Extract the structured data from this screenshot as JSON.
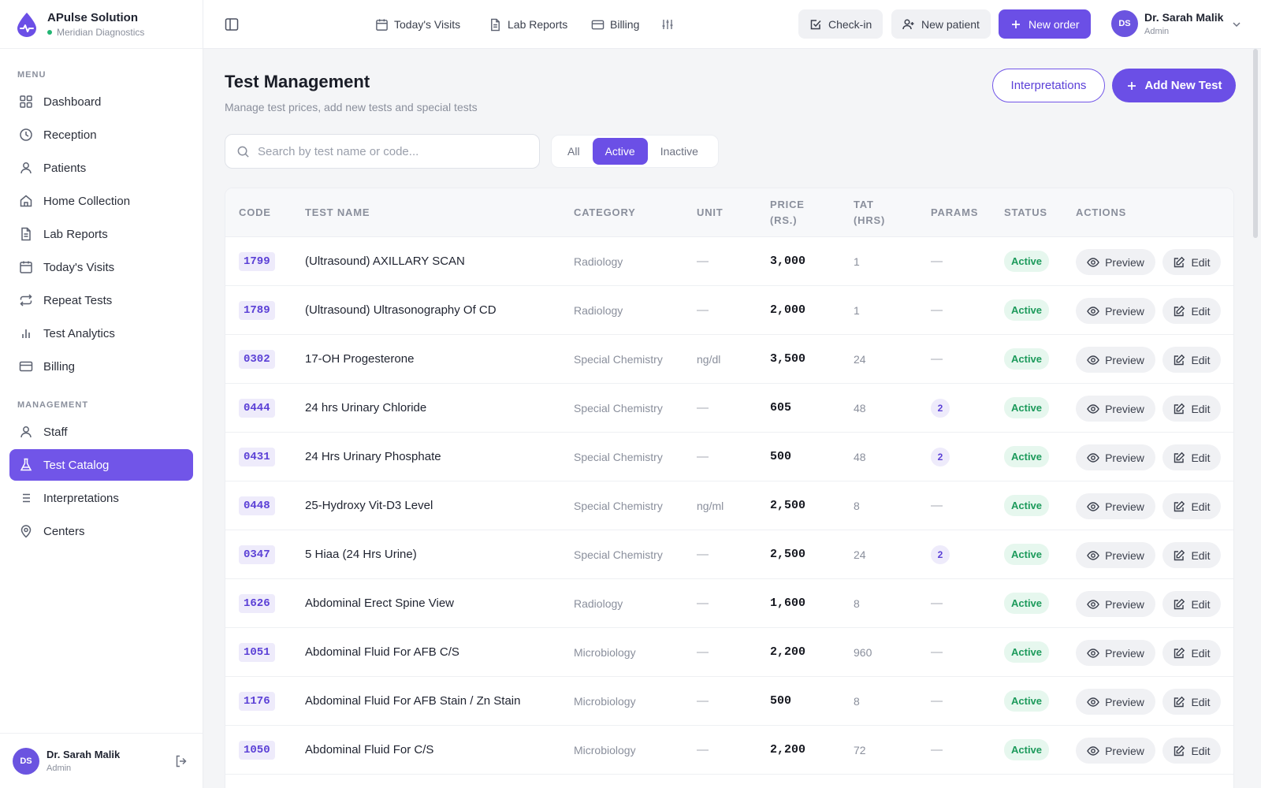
{
  "brand": {
    "name": "APulse Solution",
    "subtitle": "Meridian Diagnostics",
    "accent": "#6b4fe6",
    "status_color": "#22b573"
  },
  "sidebar": {
    "section_menu": "MENU",
    "section_management": "MANAGEMENT",
    "menu_items": [
      {
        "label": "Dashboard",
        "icon": "grid-icon"
      },
      {
        "label": "Reception",
        "icon": "clock-icon"
      },
      {
        "label": "Patients",
        "icon": "user-icon"
      },
      {
        "label": "Home Collection",
        "icon": "home-icon"
      },
      {
        "label": "Lab Reports",
        "icon": "file-icon"
      },
      {
        "label": "Today's Visits",
        "icon": "calendar-icon"
      },
      {
        "label": "Repeat Tests",
        "icon": "repeat-icon"
      },
      {
        "label": "Test Analytics",
        "icon": "bar-chart-icon"
      },
      {
        "label": "Billing",
        "icon": "credit-card-icon"
      }
    ],
    "management_items": [
      {
        "label": "Staff",
        "icon": "user-icon"
      },
      {
        "label": "Test Catalog",
        "icon": "flask-icon",
        "active": true
      },
      {
        "label": "Interpretations",
        "icon": "list-icon"
      },
      {
        "label": "Centers",
        "icon": "map-pin-icon"
      }
    ],
    "user": {
      "initials": "DS",
      "name": "Dr. Sarah Malik",
      "role": "Admin"
    }
  },
  "topbar": {
    "links": [
      {
        "label": "Today's Visits",
        "icon": "calendar-icon"
      },
      {
        "label": "Lab Reports",
        "icon": "file-icon"
      },
      {
        "label": "Billing",
        "icon": "credit-card-icon"
      }
    ],
    "checkin_label": "Check-in",
    "new_patient_label": "New patient",
    "new_order_label": "New order",
    "user": {
      "initials": "DS",
      "name": "Dr. Sarah Malik",
      "role": "Admin"
    }
  },
  "page": {
    "title": "Test Management",
    "subtitle": "Manage test prices, add new tests and special tests",
    "interpretations_label": "Interpretations",
    "add_label": "Add New Test"
  },
  "search": {
    "placeholder": "Search by test name or code...",
    "value": ""
  },
  "filter": {
    "options": [
      "All",
      "Active",
      "Inactive"
    ],
    "selected": "Active"
  },
  "table": {
    "headers": {
      "code": "CODE",
      "name": "TEST NAME",
      "category": "CATEGORY",
      "unit": "UNIT",
      "price_1": "PRICE",
      "price_2": "(RS.)",
      "tat_1": "TAT",
      "tat_2": "(HRS)",
      "params": "PARAMS",
      "status": "STATUS",
      "actions": "ACTIONS"
    },
    "preview_label": "Preview",
    "edit_label": "Edit",
    "rows": [
      {
        "code": "1799",
        "name": "(Ultrasound) AXILLARY SCAN",
        "category": "Radiology",
        "unit": "—",
        "price": "3,000",
        "tat": "1",
        "params": "—",
        "status": "Active"
      },
      {
        "code": "1789",
        "name": "(Ultrasound) Ultrasonography Of CD",
        "category": "Radiology",
        "unit": "—",
        "price": "2,000",
        "tat": "1",
        "params": "—",
        "status": "Active"
      },
      {
        "code": "0302",
        "name": "17-OH Progesterone",
        "category": "Special Chemistry",
        "unit": "ng/dl",
        "price": "3,500",
        "tat": "24",
        "params": "—",
        "status": "Active"
      },
      {
        "code": "0444",
        "name": "24 hrs Urinary Chloride",
        "category": "Special Chemistry",
        "unit": "—",
        "price": "605",
        "tat": "48",
        "params": "2",
        "status": "Active"
      },
      {
        "code": "0431",
        "name": "24 Hrs Urinary Phosphate",
        "category": "Special Chemistry",
        "unit": "—",
        "price": "500",
        "tat": "48",
        "params": "2",
        "status": "Active"
      },
      {
        "code": "0448",
        "name": "25-Hydroxy Vit-D3 Level",
        "category": "Special Chemistry",
        "unit": "ng/ml",
        "price": "2,500",
        "tat": "8",
        "params": "—",
        "status": "Active"
      },
      {
        "code": "0347",
        "name": "5 Hiaa (24 Hrs Urine)",
        "category": "Special Chemistry",
        "unit": "—",
        "price": "2,500",
        "tat": "24",
        "params": "2",
        "status": "Active"
      },
      {
        "code": "1626",
        "name": "Abdominal Erect Spine View",
        "category": "Radiology",
        "unit": "—",
        "price": "1,600",
        "tat": "8",
        "params": "—",
        "status": "Active"
      },
      {
        "code": "1051",
        "name": "Abdominal Fluid For AFB C/S",
        "category": "Microbiology",
        "unit": "—",
        "price": "2,200",
        "tat": "960",
        "params": "—",
        "status": "Active"
      },
      {
        "code": "1176",
        "name": "Abdominal Fluid For AFB Stain / Zn Stain",
        "category": "Microbiology",
        "unit": "—",
        "price": "500",
        "tat": "8",
        "params": "—",
        "status": "Active"
      },
      {
        "code": "1050",
        "name": "Abdominal Fluid For C/S",
        "category": "Microbiology",
        "unit": "—",
        "price": "2,200",
        "tat": "72",
        "params": "—",
        "status": "Active"
      }
    ]
  }
}
